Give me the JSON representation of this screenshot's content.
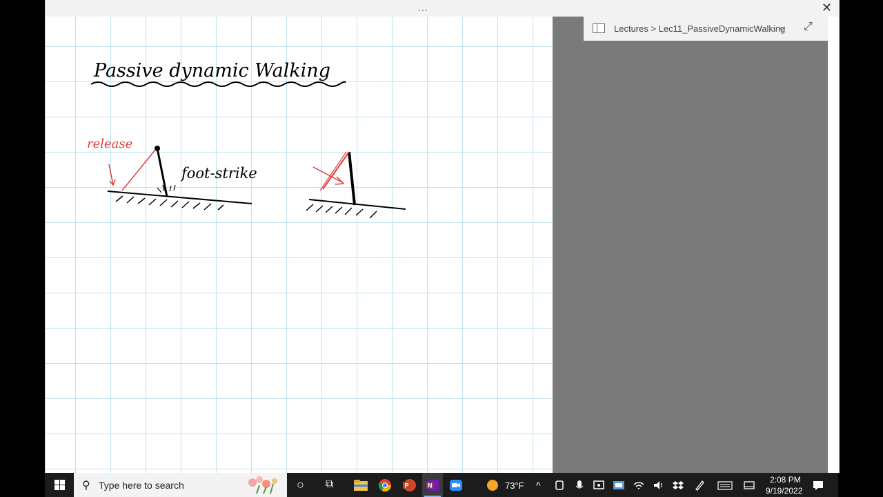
{
  "window": {
    "titlebar_dots": "...",
    "close_glyph": "✕"
  },
  "notebook": {
    "breadcrumb": "Lectures > Lec11_PassiveDynamicWalking",
    "chevron_glyph": "⌵",
    "expand_glyph": "⤢"
  },
  "note": {
    "title": "Passive dynamic Walking",
    "label_release": "release",
    "label_footstrike": "foot-strike",
    "ink_color": "#000000",
    "accent_ink_color": "#e03b3b"
  },
  "taskbar": {
    "search_placeholder": "Type here to search",
    "search_glyph": "⚲",
    "cortana_glyph": "○",
    "task_view_glyph": "⧉",
    "weather_temp": "73°F",
    "time": "2:08 PM",
    "date": "9/19/2022",
    "chevron_up_glyph": "^"
  }
}
